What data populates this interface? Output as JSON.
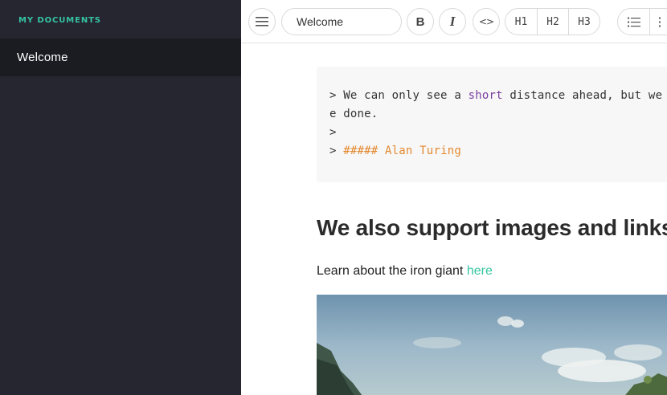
{
  "sidebar": {
    "heading": "MY DOCUMENTS",
    "items": [
      {
        "label": "Welcome",
        "active": true
      }
    ]
  },
  "toolbar": {
    "title_value": "Welcome",
    "menu_icon": "hamburger-menu-icon",
    "bold_label": "B",
    "italic_label": "I",
    "code_label": "<>",
    "headings": [
      "H1",
      "H2",
      "H3"
    ],
    "list_icon": "bulleted-list-icon"
  },
  "document": {
    "code_lines": [
      {
        "prefix": "> We can only see a ",
        "keyword": "short",
        "rest": " distance ahead, but we c"
      },
      {
        "text": "e done."
      },
      {
        "text": ">"
      },
      {
        "prefix": "> ",
        "heading_text": "##### Alan Turing"
      }
    ],
    "heading": "We also support images and links",
    "paragraph_text": "Learn about the iron giant ",
    "link_text": "here"
  },
  "colors": {
    "sidebar_bg": "#262631",
    "sidebar_active_bg": "#1b1b22",
    "accent": "#35c4a0",
    "code_keyword": "#7a3e9d",
    "code_heading": "#e4892f"
  }
}
